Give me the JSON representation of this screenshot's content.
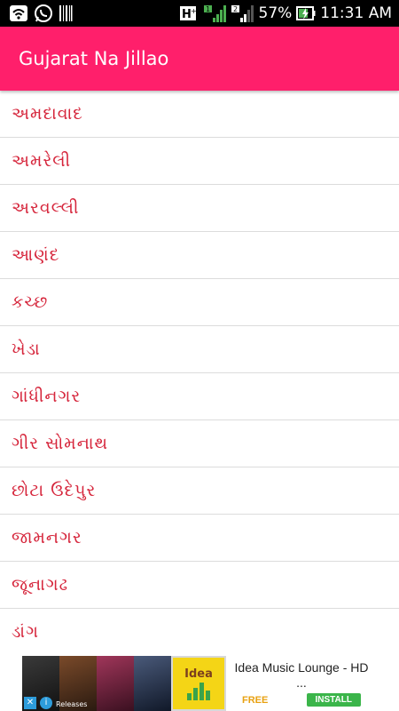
{
  "status_bar": {
    "battery_percent": "57%",
    "time": "11:31 AM",
    "icons": [
      "wifi-icon",
      "whatsapp-icon",
      "barcode-icon",
      "hplus-signal-icon",
      "signal-sim1-icon",
      "signal-sim2-icon",
      "battery-charging-icon"
    ]
  },
  "app_bar": {
    "title": "Gujarat Na Jillao"
  },
  "districts": [
    "અમદાવાદ",
    "અમરેલી",
    "અરવલ્લી",
    "આણંદ",
    "કચ્છ",
    "ખેડા",
    "ગાંધીનગર",
    "ગીર સોમનાથ",
    "છોટા ઉદેપુર",
    "જામનગર",
    "જૂનાગઢ",
    "ડાંગ"
  ],
  "ad": {
    "app_icon_text": "Idea",
    "title": "Idea Music Lounge - HD ...",
    "price": "FREE",
    "install_label": "INSTALL",
    "thumb_caption": "Releases"
  },
  "colors": {
    "accent": "#ff1f6b",
    "list_text": "#d6263c",
    "install_button": "#3bb54a"
  }
}
